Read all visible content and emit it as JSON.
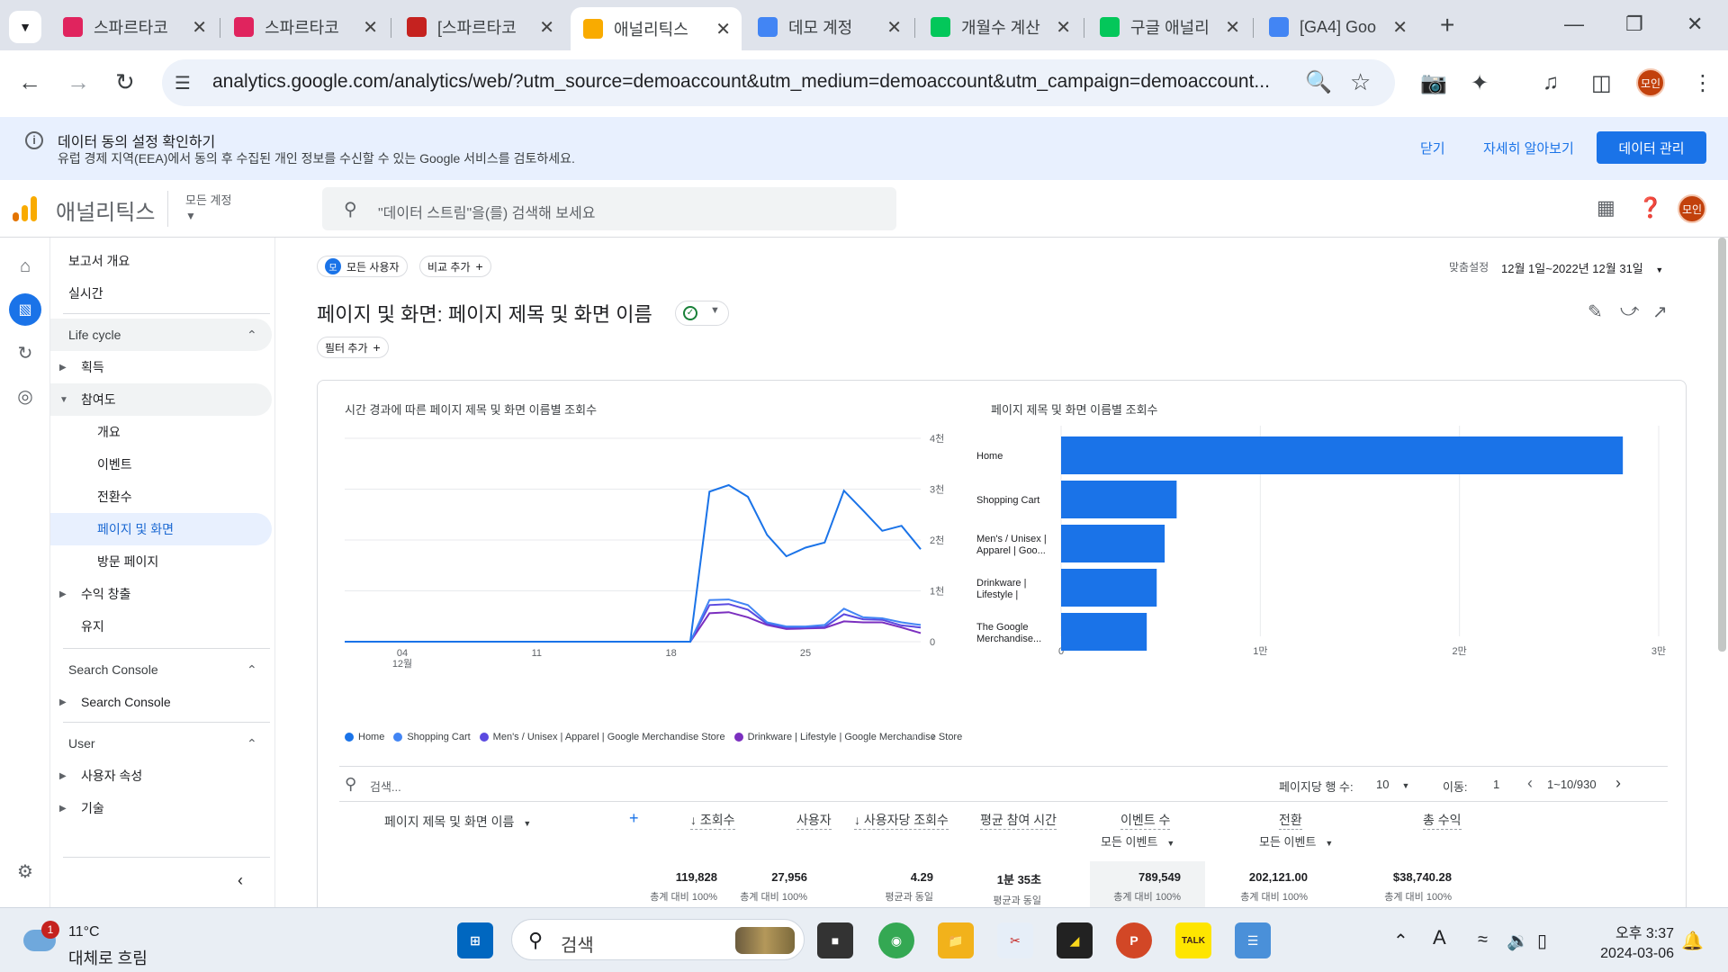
{
  "browser": {
    "tabs": [
      {
        "title": "스파르타코",
        "icon": "spartacodingclub-heart-icon",
        "color": "#e0245e"
      },
      {
        "title": "스파르타코",
        "icon": "spartacodingclub-heart-icon",
        "color": "#e0245e"
      },
      {
        "title": "[스파르타코",
        "icon": "red-book-icon",
        "color": "#c5221f"
      },
      {
        "title": "애널리틱스",
        "icon": "google-analytics-icon",
        "color": "#f9ab00"
      },
      {
        "title": "데모 계정",
        "icon": "google-g-icon",
        "color": "#4285f4"
      },
      {
        "title": "개월수 계산",
        "icon": "naver-n-icon",
        "color": "#03c75a"
      },
      {
        "title": "구글 애널리",
        "icon": "naver-blog-icon",
        "color": "#03c75a"
      },
      {
        "title": "[GA4] Goo",
        "icon": "google-g-icon",
        "color": "#4285f4"
      }
    ],
    "active_tab_index": 3,
    "url": "analytics.google.com/analytics/web/?utm_source=demoaccount&utm_medium=demoaccount&utm_campaign=demoaccount...",
    "profile_label": "모인"
  },
  "consent": {
    "title": "데이터 동의 설정 확인하기",
    "body": "유럽 경제 지역(EEA)에서 동의 후 수집된 개인 정보를 수신할 수 있는 Google 서비스를 검토하세요.",
    "close": "닫기",
    "learn_more": "자세히 알아보기",
    "manage": "데이터 관리"
  },
  "ga": {
    "product": "애널리틱스",
    "account": "모든 계정",
    "search_placeholder": "\"데이터 스트림\"을(를) 검색해 보세요",
    "avatar": "모인"
  },
  "nav": {
    "report_overview": "보고서 개요",
    "realtime": "실시간",
    "lifecycle": "Life cycle",
    "acquisition": "획득",
    "engagement": "참여도",
    "engagement_items": [
      "개요",
      "이벤트",
      "전환수",
      "페이지 및 화면",
      "방문 페이지"
    ],
    "monetization": "수익 창출",
    "retention": "유지",
    "search_console_section": "Search Console",
    "search_console_item": "Search Console",
    "user_section": "User",
    "user_attributes": "사용자 속성",
    "tech": "기술"
  },
  "report": {
    "segment_badge": "모",
    "segment": "모든 사용자",
    "add_compare": "비교 추가",
    "title": "페이지 및 화면: 페이지 제목 및 화면 이름",
    "add_filter": "필터 추가",
    "date_label": "맞춤설정",
    "date_range": "12월 1일~2022년 12월 31일",
    "line_title": "시간 경과에 따른 페이지 제목 및 화면 이름별 조회수",
    "bar_title": "페이지 제목 및 화면 이름별 조회수"
  },
  "chart_data": [
    {
      "type": "line",
      "title": "시간 경과에 따른 페이지 제목 및 화면 이름별 조회수",
      "x_ticks": [
        "04\n12월",
        "11",
        "18",
        "25"
      ],
      "x": [
        "12-01",
        "12-02",
        "12-03",
        "12-04",
        "12-05",
        "12-06",
        "12-07",
        "12-08",
        "12-09",
        "12-10",
        "12-11",
        "12-12",
        "12-13",
        "12-14",
        "12-15",
        "12-16",
        "12-17",
        "12-18",
        "12-19",
        "12-20",
        "12-21",
        "12-22",
        "12-23",
        "12-24",
        "12-25",
        "12-26",
        "12-27",
        "12-28",
        "12-29",
        "12-30",
        "12-31"
      ],
      "y_ticks": [
        "0",
        "1천",
        "2천",
        "3천",
        "4천"
      ],
      "ylim": [
        0,
        4000
      ],
      "series": [
        {
          "name": "Home",
          "color": "#1a73e8",
          "values": [
            0,
            0,
            0,
            0,
            0,
            0,
            0,
            0,
            0,
            0,
            0,
            0,
            0,
            0,
            0,
            0,
            0,
            0,
            0,
            2950,
            3080,
            2850,
            2100,
            1680,
            1850,
            1950,
            2970,
            2580,
            2180,
            2280,
            1820
          ]
        },
        {
          "name": "Shopping Cart",
          "color": "#4285f4",
          "values": [
            0,
            0,
            0,
            0,
            0,
            0,
            0,
            0,
            0,
            0,
            0,
            0,
            0,
            0,
            0,
            0,
            0,
            0,
            0,
            820,
            830,
            720,
            380,
            300,
            300,
            330,
            650,
            480,
            460,
            380,
            330
          ]
        },
        {
          "name": "Men's / Unisex | Apparel | Google Merchandise Store",
          "color": "#5b4ae0",
          "values": [
            0,
            0,
            0,
            0,
            0,
            0,
            0,
            0,
            0,
            0,
            0,
            0,
            0,
            0,
            0,
            0,
            0,
            0,
            0,
            720,
            740,
            630,
            350,
            280,
            280,
            290,
            540,
            440,
            430,
            320,
            280
          ]
        },
        {
          "name": "Drinkware | Lifestyle | Google Merchandise Store",
          "color": "#7b2fbf",
          "values": [
            0,
            0,
            0,
            0,
            0,
            0,
            0,
            0,
            0,
            0,
            0,
            0,
            0,
            0,
            0,
            0,
            0,
            0,
            0,
            560,
            580,
            480,
            330,
            250,
            260,
            270,
            400,
            380,
            380,
            280,
            170
          ]
        }
      ],
      "legend": [
        "Home",
        "Shopping Cart",
        "Men's / Unisex | Apparel | Google Merchandise Store",
        "Drinkware | Lifestyle | Google Merchandise Store"
      ]
    },
    {
      "type": "bar",
      "orientation": "horizontal",
      "title": "페이지 제목 및 화면 이름별 조회수",
      "categories": [
        "Home",
        "Shopping Cart",
        "Men's / Unisex | Apparel | Goo...",
        "Drinkware | Lifestyle | Go...",
        "The Google Merchandise..."
      ],
      "values": [
        28200,
        5800,
        5200,
        4800,
        4300
      ],
      "x_ticks": [
        "0",
        "1만",
        "2만",
        "3만"
      ],
      "xlim": [
        0,
        30000
      ],
      "color": "#1a73e8"
    }
  ],
  "table": {
    "search_placeholder": "검색...",
    "rows_per_page_label": "페이지당 행 수:",
    "rows_per_page": "10",
    "goto_label": "이동:",
    "goto_value": "1",
    "pagination": "1~10/930",
    "dimension": "페이지 제목 및 화면 이름",
    "columns": [
      "조회수",
      "사용자",
      "사용자당 조회수",
      "평균 참여 시간",
      "이벤트 수",
      "전환",
      "총 수익"
    ],
    "sub_event": "모든 이벤트",
    "sub_conv": "모든 이벤트",
    "totals": [
      "119,828",
      "27,956",
      "4.29",
      "1분 35초",
      "789,549",
      "202,121.00",
      "$38,740.28"
    ],
    "totals_sub": [
      "총계 대비 100%",
      "총계 대비 100%",
      "평균과 동일",
      "평균과 동일",
      "총계 대비 100%",
      "총계 대비 100%",
      "총계 대비 100%"
    ]
  },
  "taskbar": {
    "weather_badge": "1",
    "temp": "11°C",
    "weather": "대체로 흐림",
    "search": "검색",
    "time": "오후 3:37",
    "date": "2024-03-06",
    "ime": "A"
  }
}
